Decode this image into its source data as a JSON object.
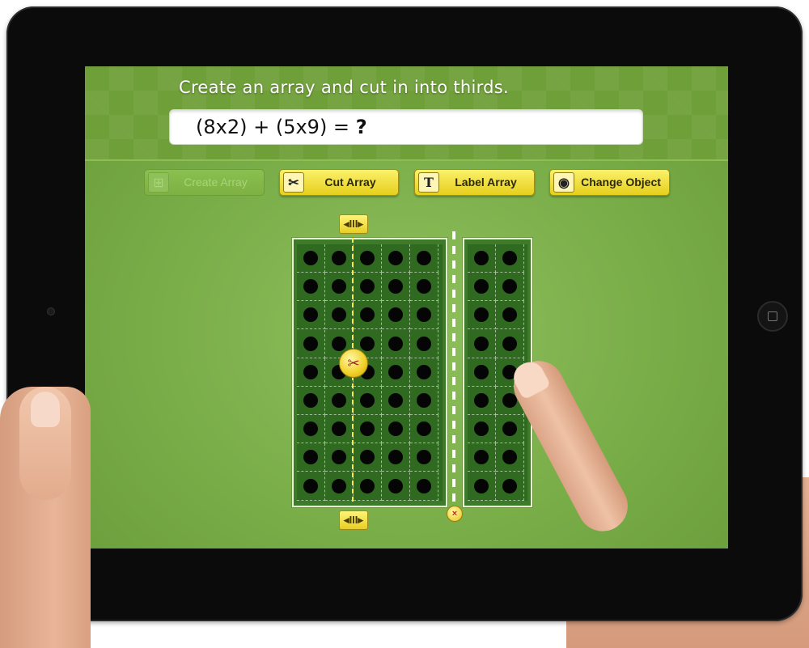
{
  "screen": {
    "prompt": "Create an array and cut in into thirds.",
    "equation": {
      "expression": "(8x2) + (5x9) =",
      "answer_placeholder": "?"
    }
  },
  "toolbar": {
    "buttons": [
      {
        "label": "Create Array",
        "icon": "grid-add-icon",
        "enabled": false
      },
      {
        "label": "Cut Array",
        "icon": "scissors-icon",
        "enabled": true
      },
      {
        "label": "Label Array",
        "icon": "text-t-icon",
        "enabled": true
      },
      {
        "label": "Change Object",
        "icon": "change-object-icon",
        "enabled": true
      }
    ]
  },
  "array": {
    "left_section": {
      "columns": 5,
      "rows": 9
    },
    "right_section": {
      "columns": 2,
      "rows": 9
    },
    "cut_after_column": 2
  },
  "icons": {
    "marker_glyph": "◂III▸",
    "scissors_glyph": "✂",
    "close_glyph": "×",
    "t_glyph": "T"
  },
  "colors": {
    "screen_green": "#79ad48",
    "button_yellow": "#fbf16a",
    "array_green": "#2f6a20"
  }
}
